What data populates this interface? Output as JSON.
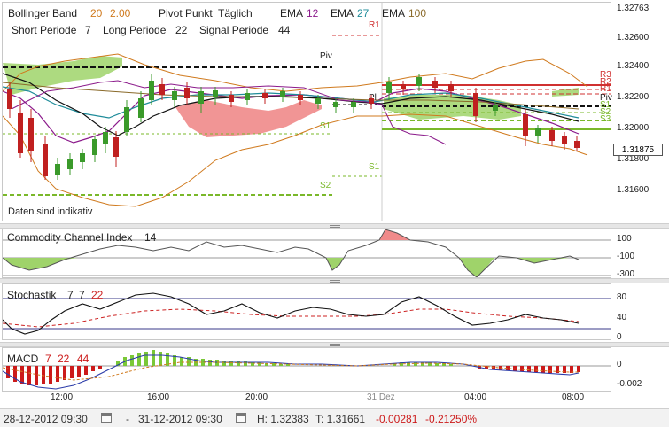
{
  "header": {
    "bb_label": "Bollinger Band",
    "bb_p1": "20",
    "bb_p2": "2.00",
    "pivot_label": "Pivot Punkt",
    "pivot_mode": "Täglich",
    "ema_label": "EMA",
    "ema1": "12",
    "ema2": "27",
    "ema3": "100",
    "short_label": "Short Periode",
    "short_val": "7",
    "long_label": "Long Periode",
    "long_val": "22",
    "signal_label": "Signal Periode",
    "signal_val": "44",
    "disclaimer": "Daten sind indikativ"
  },
  "price_axis": [
    "1.32763",
    "1.32600",
    "1.32400",
    "1.32200",
    "1.32000",
    "1.31800",
    "1.31600"
  ],
  "current_price": "1.31875",
  "pivot_tags_left": {
    "r1": "R1",
    "piv": "Piv",
    "s1a": "S1",
    "s1b": "S1",
    "s2": "S2",
    "pl": "Pl"
  },
  "pivot_tags_right": {
    "r3": "R3",
    "r2": "R2",
    "r1": "R1",
    "piv": "Piv",
    "s1": "S1",
    "s2": "S2",
    "s3": "S3"
  },
  "cci": {
    "label": "Commodity Channel Index",
    "period": "14",
    "ticks": [
      "100",
      "-100",
      "-300"
    ]
  },
  "stoch": {
    "label": "Stochastik",
    "p1": "7",
    "p2": "7",
    "p3": "22",
    "ticks": [
      "80",
      "40",
      "0"
    ]
  },
  "macd": {
    "label": "MACD",
    "p1": "7",
    "p2": "22",
    "p3": "44",
    "ticks": [
      "0",
      "-0.002"
    ]
  },
  "time_axis": [
    "12:00",
    "16:00",
    "20:00",
    "31 Dez",
    "04:00",
    "08:00"
  ],
  "footer": {
    "from": "28-12-2012 09:30",
    "sep": "-",
    "to": "31-12-2012 09:30",
    "high": "H: 1.32383",
    "low": "T: 1.31661",
    "change": "-0.00281",
    "change_pct": "-0.21250%"
  },
  "colors": {
    "bb": "#d07a1e",
    "ema12": "#8b1a8b",
    "ema27": "#1f8c9a",
    "ema100": "#8a6a2a",
    "pivot_red": "#d03030",
    "pivot_green": "#7ab82a",
    "cloud_green": "#9fd36a",
    "cloud_red": "#f08a8a",
    "candle_up": "#3a9a2a",
    "candle_down": "#c02020",
    "macd_pos": "#7ac836",
    "macd_neg": "#cc1a1a",
    "stoch_line": "#111111",
    "stoch_sig": "#cc2222"
  }
}
